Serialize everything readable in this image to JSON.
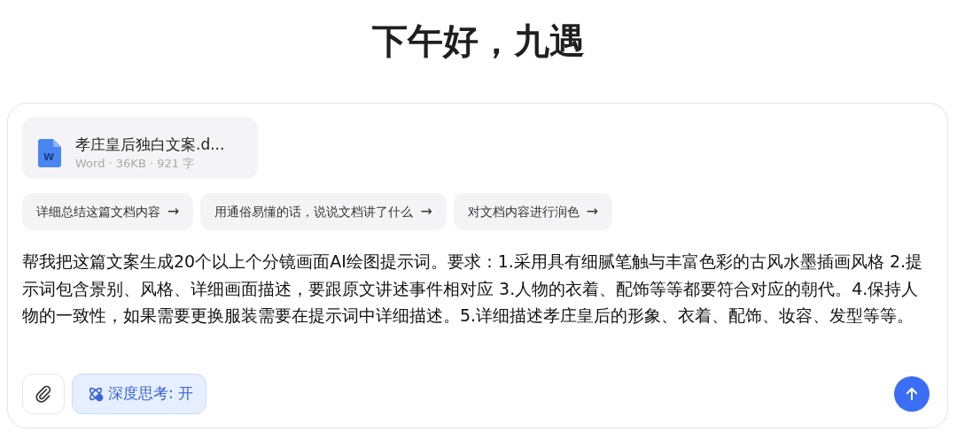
{
  "greeting": "下午好，九遇",
  "attachment": {
    "name": "孝庄皇后独白文案.d...",
    "meta": "Word · 36KB · 921 字",
    "badge": "W"
  },
  "suggestions": [
    {
      "label": "详细总结这篇文档内容",
      "arrow": "→"
    },
    {
      "label": "用通俗易懂的话，说说文档讲了什么",
      "arrow": "→"
    },
    {
      "label": "对文档内容进行润色",
      "arrow": "→"
    }
  ],
  "prompt": {
    "value": "帮我把这篇文案生成20个以上个分镜画面AI绘图提示词。要求：1.采用具有细腻笔触与丰富色彩的古风水墨插画风格 2.提示词包含景别、风格、详细画面描述，要跟原文讲述事件相对应 3.人物的衣着、配饰等等都要符合对应的朝代。4.保持人物的一致性，如果需要更换服装需要在提示词中详细描述。5.详细描述孝庄皇后的形象、衣着、配饰、妆容、发型等等。"
  },
  "deep_think": {
    "label": "深度思考: 开",
    "on": true
  }
}
